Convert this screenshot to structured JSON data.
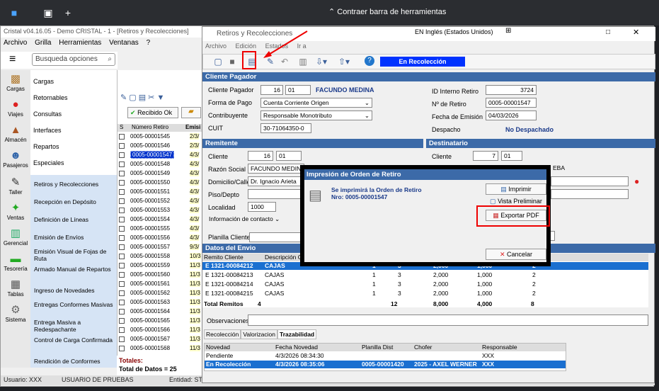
{
  "topbar": {
    "collapse_label": "Contraer barra de herramientas"
  },
  "app": {
    "title": "Cristal v04.16.05 - Demo CRISTAL - 1 - [Retiros y Recolecciones]",
    "menu": [
      "Archivo",
      "Grilla",
      "Herramientas",
      "Ventanas",
      "?"
    ],
    "search_placeholder": "Busqueda opciones"
  },
  "nav": [
    {
      "label": "Cargas",
      "icon": "box-icon"
    },
    {
      "label": "Viajes",
      "icon": "map-pin-icon"
    },
    {
      "label": "Almacén",
      "icon": "warehouse-icon"
    },
    {
      "label": "Pasajeros",
      "icon": "person-icon"
    },
    {
      "label": "Taller",
      "icon": "wrench-icon"
    },
    {
      "label": "Ventas",
      "icon": "sales-icon"
    },
    {
      "label": "Gerencial",
      "icon": "chart-icon"
    },
    {
      "label": "Tesorería",
      "icon": "money-icon"
    },
    {
      "label": "Tablas",
      "icon": "table-icon"
    },
    {
      "label": "Sistema",
      "icon": "gear-icon"
    }
  ],
  "submenu": [
    "Cargas",
    "Retornables",
    "Consultas",
    "Interfaces",
    "Repartos",
    "Especiales"
  ],
  "submenu2": [
    "Retiros y Recolecciones",
    "Recepción en Depósito",
    "Definición de Líneas",
    "Emisión de Envíos",
    "Emisión Visual de Fojas de Ruta",
    "Armado Manual de Repartos",
    "Ingreso de Novedades",
    "Entregas Conformes Masivas",
    "Entrega Masiva a Redespachante",
    "Control de Carga Confirmada",
    "Rendición de Conformes"
  ],
  "mid": {
    "title": "Retiros y Recolec",
    "received_btn": "Recibido Ok",
    "col_s": "S",
    "col_num": "Número Retiro",
    "col_date": "Emisi",
    "rows": [
      {
        "num": "0005-00001545",
        "d": "2/3/"
      },
      {
        "num": "0005-00001546",
        "d": "2/3/"
      },
      {
        "num": "0005-00001547",
        "d": "4/3/"
      },
      {
        "num": "0005-00001548",
        "d": "4/3/"
      },
      {
        "num": "0005-00001549",
        "d": "4/3/"
      },
      {
        "num": "0005-00001550",
        "d": "4/3/"
      },
      {
        "num": "0005-00001551",
        "d": "4/3/"
      },
      {
        "num": "0005-00001552",
        "d": "4/3/"
      },
      {
        "num": "0005-00001553",
        "d": "4/3/"
      },
      {
        "num": "0005-00001554",
        "d": "4/3/"
      },
      {
        "num": "0005-00001555",
        "d": "4/3/"
      },
      {
        "num": "0005-00001556",
        "d": "4/3/"
      },
      {
        "num": "0005-00001557",
        "d": "9/3/"
      },
      {
        "num": "0005-00001558",
        "d": "10/3"
      },
      {
        "num": "0005-00001559",
        "d": "11/3"
      },
      {
        "num": "0005-00001560",
        "d": "11/3"
      },
      {
        "num": "0005-00001561",
        "d": "11/3"
      },
      {
        "num": "0005-00001562",
        "d": "11/3"
      },
      {
        "num": "0005-00001563",
        "d": "11/3"
      },
      {
        "num": "0005-00001564",
        "d": "11/3"
      },
      {
        "num": "0005-00001565",
        "d": "11/3"
      },
      {
        "num": "0005-00001566",
        "d": "11/3"
      },
      {
        "num": "0005-00001567",
        "d": "11/3"
      },
      {
        "num": "0005-00001568",
        "d": "11/3"
      }
    ],
    "totals_label": "Totales:",
    "total_data": "Total de Datos = 25"
  },
  "status": {
    "user": "Usuario: XXX",
    "user2": "USUARIO DE PRUEBAS",
    "entity": "Entidad: ST"
  },
  "win": {
    "title": "Retiros y Recolecciones",
    "lang": "EN Inglés (Estados Unidos)",
    "menu": [
      "Archivo",
      "Edición",
      "Estados",
      "Ir a"
    ],
    "badge": "En Recolección"
  },
  "cliente": {
    "header": "Cliente Pagador",
    "l_cliente": "Cliente Pagador",
    "cliente_num": "16",
    "cliente_code": "01",
    "cliente_name": "FACUNDO MEDINA",
    "l_forma": "Forma de Pago",
    "forma": "Cuenta Corriente Origen",
    "l_contrib": "Contribuyente",
    "contrib": "Responsable Monotributo",
    "l_cuit": "CUIT",
    "cuit": "30-71064350-0",
    "l_id": "ID Interno Retiro",
    "id": "3724",
    "l_nro": "Nº de Retiro",
    "nro": "0005-00001547",
    "l_fecha": "Fecha de Emisión",
    "fecha": "04/03/2026",
    "l_desp": "Despacho",
    "desp": "No Despachado"
  },
  "remitente": {
    "header": "Remitente",
    "l_cliente": "Cliente",
    "num": "16",
    "code": "01",
    "l_razon": "Razón Social",
    "razon": "FACUNDO MEDINA",
    "l_dom": "Domicilio/Calle",
    "dom": "Dr. Ignacio Arieta",
    "l_piso": "Piso/Depto",
    "l_loc": "Localidad",
    "loc": "1000",
    "info": "Información de contacto"
  },
  "destinatario": {
    "header": "Destinatario",
    "l_cliente": "Cliente",
    "num": "7",
    "code": "01",
    "partial": "EBA"
  },
  "envio": {
    "l_planilla": "Planilla Cliente",
    "header": "Datos del Envio",
    "col_remito": "Remito Cliente",
    "col_desc": "Descripción C",
    "rows": [
      {
        "r": "E 1321-00084212",
        "d": "CAJAS",
        "a": "1",
        "b": "3",
        "c": "2,000",
        "e": "1,000",
        "f": "2"
      },
      {
        "r": "E 1321-00084213",
        "d": "CAJAS",
        "a": "1",
        "b": "3",
        "c": "2,000",
        "e": "1,000",
        "f": "2"
      },
      {
        "r": "E 1321-00084214",
        "d": "CAJAS",
        "a": "1",
        "b": "3",
        "c": "2,000",
        "e": "1,000",
        "f": "2"
      },
      {
        "r": "E 1321-00084215",
        "d": "CAJAS",
        "a": "1",
        "b": "3",
        "c": "2,000",
        "e": "1,000",
        "f": "2"
      }
    ],
    "total_label": "Total Remitos",
    "total_r": "4",
    "tot_b": "12",
    "tot_c": "8,000",
    "tot_e": "4,000",
    "tot_f": "8",
    "l_obs": "Observaciones"
  },
  "tabs": [
    "Recolección",
    "Valorizacion",
    "Trazabilidad"
  ],
  "traz": {
    "cols": [
      "Novedad",
      "Fecha Novedad",
      "Planilla Dist",
      "Chofer",
      "Responsable"
    ],
    "rows": [
      {
        "n": "Pendiente",
        "f": "4/3/2026 08:34:30",
        "p": "",
        "c": "",
        "r": "XXX"
      },
      {
        "n": "En Recolección",
        "f": "4/3/2026 08:35:06",
        "p": "0005-00001420",
        "c": "2025 - AXEL WERNER",
        "r": "XXX"
      }
    ]
  },
  "dialog": {
    "title": "Impresión de Orden de Retiro",
    "msg1": "Se imprimirá la Orden de Retiro",
    "msg2": "Nro: 0005-00001547",
    "imprimir": "Imprimir",
    "vista": "Vista Preliminar",
    "exportar": "Exportar PDF",
    "cancelar": "Cancelar"
  }
}
